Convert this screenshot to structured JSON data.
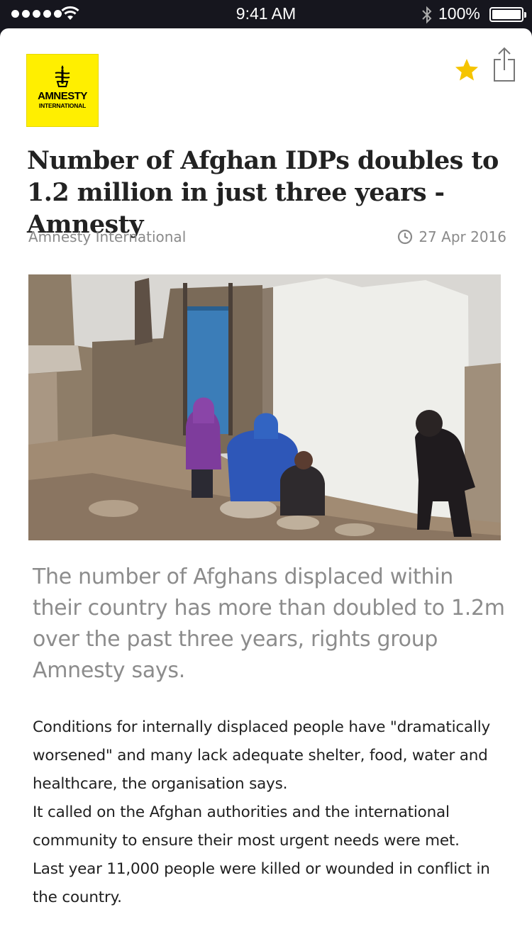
{
  "status_bar": {
    "time": "9:41 AM",
    "battery_percent": "100%",
    "signal_bars": 5,
    "battery_level": 1.0
  },
  "article": {
    "publisher_logo": {
      "line1": "AMNESTY",
      "line2": "INTERNATIONAL",
      "background_color": "#ffef00"
    },
    "favorite_icon": "star-icon",
    "favorited": true,
    "share_icon": "share-icon",
    "accent_color": "#f5c400",
    "headline": "Number of Afghan IDPs doubles to 1.2 million in just three years - Amnesty",
    "source": "Amnesty International",
    "date": "27 Apr 2016",
    "date_icon": "clock-icon",
    "lead": "The number of Afghans displaced within their country has more than doubled to 1.2m over the past three years, rights group Amnesty says.",
    "paragraphs": [
      "Conditions for internally displaced people have \"dramatically worsened\" and many lack adequate shelter, food, water and healthcare, the organisation says.",
      "It called on the Afghan authorities and the international community to ensure their most urgent needs were met.",
      "Last year 11,000 people were killed or wounded in conflict in the country."
    ]
  }
}
